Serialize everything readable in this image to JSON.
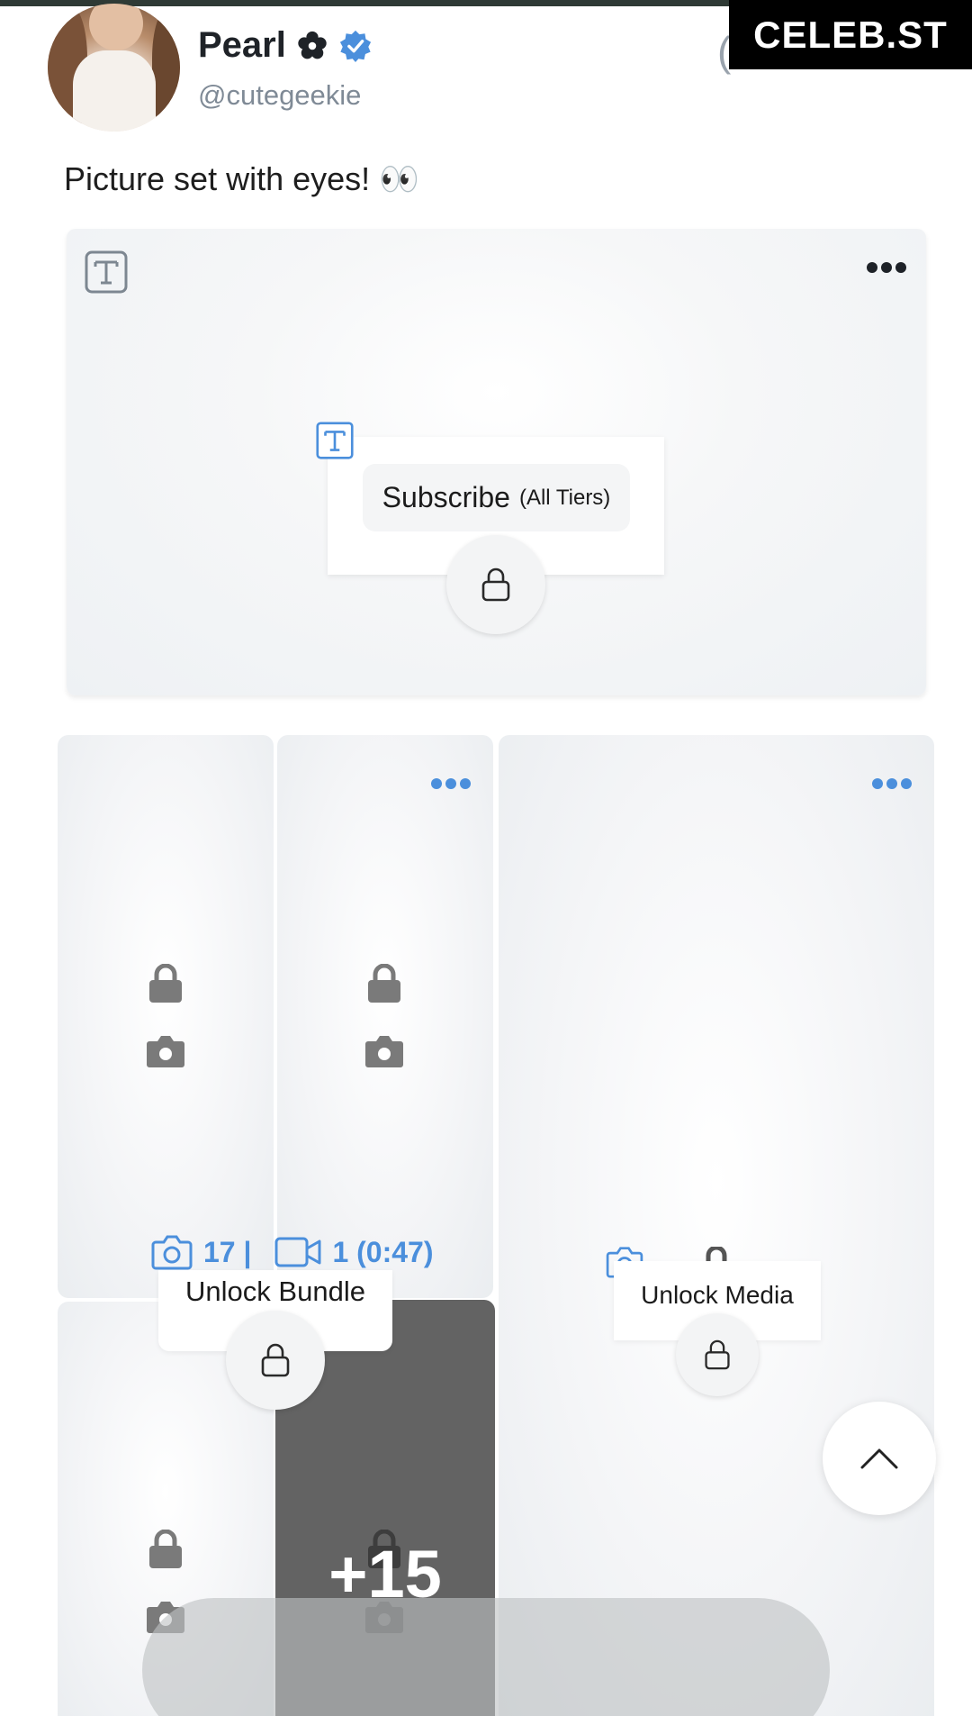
{
  "watermark": {
    "text": "CELEB.ST",
    "partial_char": "("
  },
  "author": {
    "name": "Pearl",
    "handle": "@cutegeekie",
    "badge_icon": "flower-icon",
    "verified_icon": "verified-badge-icon",
    "verified_color": "#4b8fdc"
  },
  "post": {
    "text": "Picture set with eyes! 👀",
    "locked_card": {
      "subscribe_label": "Subscribe",
      "subscribe_tier": "(All Tiers)"
    }
  },
  "bundle": {
    "photo_count": "17 |",
    "video_count": "1 (0:47)",
    "unlock_label": "Unlock Bundle",
    "more_count": "+15"
  },
  "single_media": {
    "unlock_label": "Unlock Media"
  },
  "colors": {
    "accent": "#4b8fdc",
    "lock_gray": "#7a7a7a"
  }
}
